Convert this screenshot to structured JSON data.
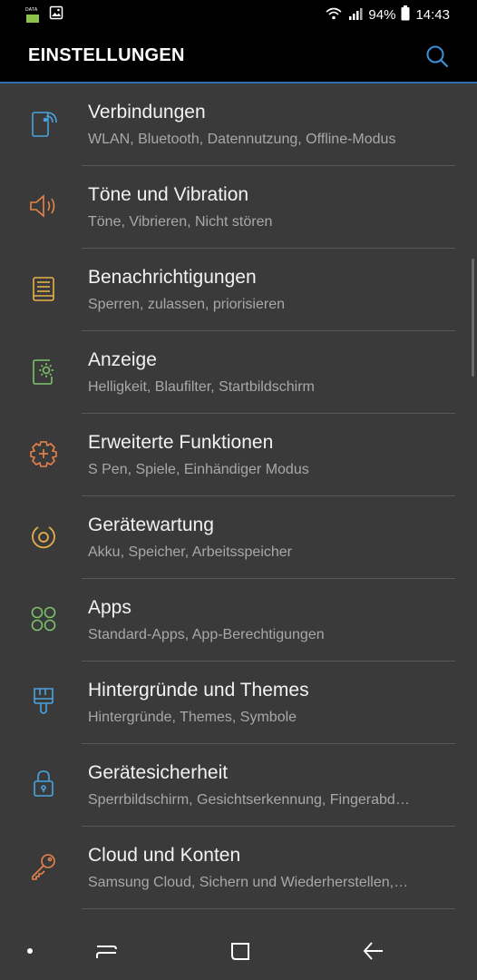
{
  "status": {
    "battery_percent": "94%",
    "time": "14:43",
    "data_label": "DATA"
  },
  "header": {
    "title": "EINSTELLUNGEN"
  },
  "items": [
    {
      "title": "Verbindungen",
      "subtitle": "WLAN, Bluetooth, Datennutzung, Offline-Modus",
      "icon": "connections-icon",
      "color": "#4aa3df"
    },
    {
      "title": "Töne und Vibration",
      "subtitle": "Töne, Vibrieren, Nicht stören",
      "icon": "sound-icon",
      "color": "#e8834a"
    },
    {
      "title": "Benachrichtigungen",
      "subtitle": "Sperren, zulassen, priorisieren",
      "icon": "notifications-icon",
      "color": "#e6b04a"
    },
    {
      "title": "Anzeige",
      "subtitle": "Helligkeit, Blaufilter, Startbildschirm",
      "icon": "display-icon",
      "color": "#7cc26a"
    },
    {
      "title": "Erweiterte Funktionen",
      "subtitle": "S Pen, Spiele, Einhändiger Modus",
      "icon": "advanced-features-icon",
      "color": "#e8834a"
    },
    {
      "title": "Gerätewartung",
      "subtitle": "Akku, Speicher, Arbeitsspeicher",
      "icon": "device-maintenance-icon",
      "color": "#e6b04a"
    },
    {
      "title": "Apps",
      "subtitle": "Standard-Apps, App-Berechtigungen",
      "icon": "apps-icon",
      "color": "#7cc26a"
    },
    {
      "title": "Hintergründe und Themes",
      "subtitle": "Hintergründe, Themes, Symbole",
      "icon": "themes-icon",
      "color": "#4aa3df"
    },
    {
      "title": "Gerätesicherheit",
      "subtitle": "Sperrbildschirm, Gesichtserkennung, Fingerabd…",
      "icon": "security-lock-icon",
      "color": "#4aa3df"
    },
    {
      "title": "Cloud und Konten",
      "subtitle": "Samsung Cloud, Sichern und Wiederherstellen,…",
      "icon": "key-icon",
      "color": "#e8834a"
    }
  ]
}
